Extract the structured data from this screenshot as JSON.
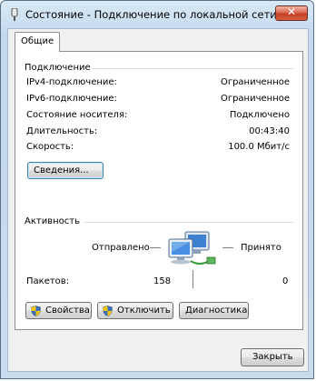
{
  "window": {
    "title": "Состояние - Подключение по локальной сети",
    "close_label": "✕"
  },
  "tabs": [
    {
      "label": "Общие"
    }
  ],
  "connection": {
    "group_label": "Подключение",
    "rows": [
      {
        "label": "IPv4-подключение:",
        "value": "Ограниченное"
      },
      {
        "label": "IPv6-подключение:",
        "value": "Ограниченное"
      },
      {
        "label": "Состояние носителя:",
        "value": "Подключено"
      },
      {
        "label": "Длительность:",
        "value": "00:43:40"
      },
      {
        "label": "Скорость:",
        "value": "100.0 Мбит/с"
      }
    ],
    "details_button": "Сведения..."
  },
  "activity": {
    "group_label": "Активность",
    "sent_label": "Отправлено",
    "received_label": "Принято",
    "packets_label": "Пакетов:",
    "packets_sent": "158",
    "packets_received": "0",
    "icon": "network-computers-icon"
  },
  "actions": {
    "properties": "Свойства",
    "disable": "Отключить",
    "diagnose": "Диагностика"
  },
  "footer": {
    "close_button": "Закрыть"
  },
  "colors": {
    "titlebar": "#c2d9ee",
    "close_button": "#c23f26",
    "focus_border": "#3c7fb1",
    "shield_blue": "#3b6fc1",
    "shield_yellow": "#f2c600"
  }
}
